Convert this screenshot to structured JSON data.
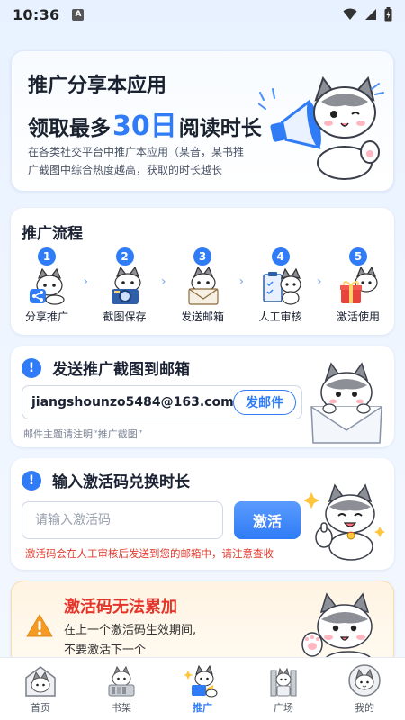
{
  "status_bar": {
    "time": "10:36",
    "notif_glyph": "A"
  },
  "banner": {
    "title": "推广分享本应用",
    "sub_pre": "领取最多",
    "sub_highlight": "30日",
    "sub_post": "阅读时长",
    "desc": "在各类社交平台中推广本应用（某音，某书推广截图中综合热度越高，获取的时长越长",
    "icon": "cat-megaphone-icon"
  },
  "process": {
    "title": "推广流程",
    "steps": [
      {
        "num": "1",
        "label": "分享推广",
        "icon": "share-icon"
      },
      {
        "num": "2",
        "label": "截图保存",
        "icon": "camera-icon"
      },
      {
        "num": "3",
        "label": "发送邮箱",
        "icon": "mail-icon"
      },
      {
        "num": "4",
        "label": "人工审核",
        "icon": "clipboard-icon"
      },
      {
        "num": "5",
        "label": "激活使用",
        "icon": "gift-icon"
      }
    ],
    "arrow": "›"
  },
  "email_section": {
    "badge": "!",
    "title": "发送推广截图到邮箱",
    "address": "jiangshounzo5484@163.com",
    "send_label": "发邮件",
    "hint": "邮件主题请注明“推广截图”"
  },
  "redeem_section": {
    "badge": "!",
    "title": "输入激活码兑换时长",
    "placeholder": "请输入激活码",
    "button_label": "激活",
    "warning": "激活码会在人工审核后发送到您的邮箱中，请注意查收"
  },
  "notice": {
    "title": "激活码无法累加",
    "line1": "在上一个激活码生效期间,",
    "line2": "不要激活下一个"
  },
  "bottom_nav": [
    {
      "label": "首页",
      "icon": "home-cat-icon",
      "active": false
    },
    {
      "label": "书架",
      "icon": "bookshelf-cat-icon",
      "active": false
    },
    {
      "label": "推广",
      "icon": "promote-cat-icon",
      "active": true
    },
    {
      "label": "广场",
      "icon": "plaza-cat-icon",
      "active": false
    },
    {
      "label": "我的",
      "icon": "profile-cat-icon",
      "active": false
    }
  ],
  "colors": {
    "accent": "#2f7cf6",
    "warning_red": "#e5352a",
    "notice_bg": "#fff4e3"
  }
}
